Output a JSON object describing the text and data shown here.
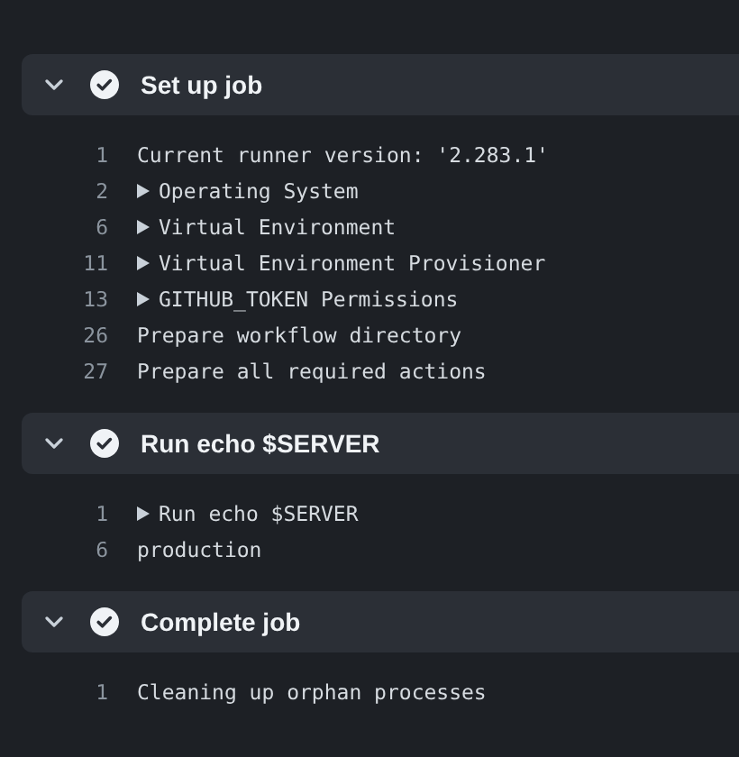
{
  "steps": [
    {
      "title": "Set up job",
      "succeeded": true,
      "expanded": true,
      "lines": [
        {
          "number": "1",
          "kind": "plain",
          "text": "Current runner version: '2.283.1'"
        },
        {
          "number": "2",
          "kind": "group",
          "text": "Operating System"
        },
        {
          "number": "6",
          "kind": "group",
          "text": "Virtual Environment"
        },
        {
          "number": "11",
          "kind": "group",
          "text": "Virtual Environment Provisioner"
        },
        {
          "number": "13",
          "kind": "group",
          "text": "GITHUB_TOKEN Permissions"
        },
        {
          "number": "26",
          "kind": "plain",
          "text": "Prepare workflow directory"
        },
        {
          "number": "27",
          "kind": "plain",
          "text": "Prepare all required actions"
        }
      ]
    },
    {
      "title": "Run echo $SERVER",
      "succeeded": true,
      "expanded": true,
      "lines": [
        {
          "number": "1",
          "kind": "group",
          "text": "Run echo $SERVER"
        },
        {
          "number": "6",
          "kind": "plain",
          "text": "production"
        }
      ]
    },
    {
      "title": "Complete job",
      "succeeded": true,
      "expanded": true,
      "lines": [
        {
          "number": "1",
          "kind": "plain",
          "text": "Cleaning up orphan processes"
        }
      ]
    }
  ]
}
